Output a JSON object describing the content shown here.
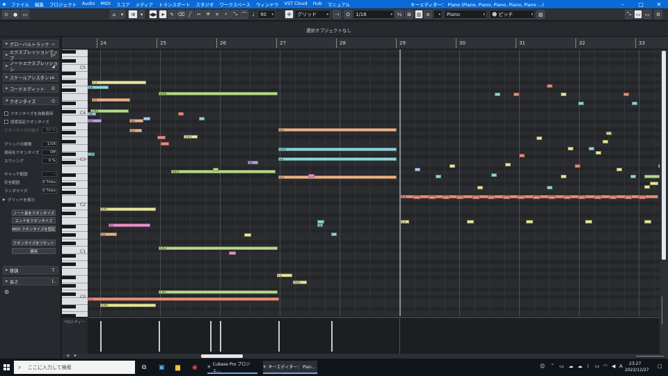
{
  "menubar": {
    "items": [
      "ファイル",
      "編集",
      "プロジェクト",
      "Audio",
      "MIDI",
      "スコア",
      "メディア",
      "トランスポート",
      "スタジオ",
      "ワークスペース",
      "ウィンドウ",
      "VST Cloud",
      "Hub",
      "マニュアル"
    ],
    "window_title": "キーエディター： Piano (Piano, Piano, Piano, Piano, Piano ...)"
  },
  "toolbar": {
    "velocity_value": "90",
    "snap_mode": "グリッド",
    "quantize_value": "1/16",
    "track_name": "Piano",
    "pitch_mode": "ピッチ"
  },
  "infoline": {
    "status": "選択オブジェクトなし"
  },
  "inspector": {
    "sections_top": [
      "グローバルトラック",
      "エクスプレッションマップ",
      "ノートエクスプレッション",
      "スケールアシスタント",
      "コードエディット"
    ],
    "quantize_header": "クオンタイズ",
    "auto_quantize": "クオンタイズを自動適用",
    "iterative": "感度指定クオンタイズ",
    "strength_label": "クオンタイズの強さ",
    "strength_value": "60 %",
    "grid_label": "グリッドの間隔",
    "grid_value": "1/16",
    "applied_label": "適用をクオンタイズ",
    "applied_value": "Off",
    "swing_label": "スウィング",
    "swing_value": "0 %",
    "catch_label": "キャッチ範囲",
    "catch_value": "-",
    "safe_label": "安全範囲",
    "safe_value": "0 Ticks",
    "random_label": "ランダマイズ",
    "random_value": "0 Ticks",
    "grid_show": "グリッドを表示",
    "btn_note_len": "ノート長をクオンタイズ",
    "btn_end": "エンドをクオンタイズ",
    "btn_fix": "MIDI クオンタイズを固定",
    "btn_reset": "クオンタイズをリセット",
    "btn_apply": "適用",
    "sec_transpose": "移調",
    "sec_length": "長さ"
  },
  "ruler": {
    "bars": [
      "24",
      "25",
      "26",
      "27",
      "28",
      "29",
      "30",
      "31",
      "32",
      "33"
    ]
  },
  "keys": {
    "c_labels": [
      "C5",
      "C4",
      "C3",
      "C2",
      "C1",
      "C0"
    ]
  },
  "velocity": {
    "label": "ベロシティー"
  },
  "notes": [
    {
      "c": "nb",
      "t": "A4"
    },
    {
      "c": "no",
      "t": "G4"
    },
    {
      "c": "no",
      "t": "F4"
    },
    {
      "c": "nc",
      "t": "E4"
    },
    {
      "c": "ng",
      "t": "C#4"
    },
    {
      "c": "np",
      "t": "B3"
    },
    {
      "c": "no",
      "t": "G3"
    },
    {
      "c": "ny",
      "t": "F3"
    },
    {
      "c": "nc",
      "t": "C#3"
    },
    {
      "c": "ny",
      "t": "A#2"
    },
    {
      "c": "ng",
      "t": "C#2"
    },
    {
      "c": "np",
      "t": "B1"
    },
    {
      "c": "ny",
      "t": "A#1"
    },
    {
      "c": "nk",
      "t": "A1"
    },
    {
      "c": "no",
      "t": "G1"
    },
    {
      "c": "ny",
      "t": "F1"
    },
    {
      "c": "ng",
      "t": "C#1"
    },
    {
      "c": "nr",
      "t": "C1"
    },
    {
      "c": "ny",
      "t": "A#0"
    },
    {
      "c": "no",
      "t": "G0"
    },
    {
      "c": "ng",
      "t": "G#4"
    },
    {
      "c": "no",
      "t": "G4"
    },
    {
      "c": "nc",
      "t": "C#4"
    },
    {
      "c": "ng",
      "t": "A#3"
    },
    {
      "c": "ny",
      "t": "G#3"
    },
    {
      "c": "no",
      "t": "G3"
    },
    {
      "c": "nc",
      "t": "E3"
    },
    {
      "c": "nr",
      "t": "C3"
    },
    {
      "c": "ny",
      "t": "F2"
    },
    {
      "c": "nc",
      "t": "D2"
    }
  ],
  "taskbar": {
    "search_placeholder": "ここに入力して検索",
    "app1": "Cubase Pro プロジェ...",
    "app2": "キーエディター： Pian...",
    "time": "23:27",
    "date": "2022/12/27"
  }
}
